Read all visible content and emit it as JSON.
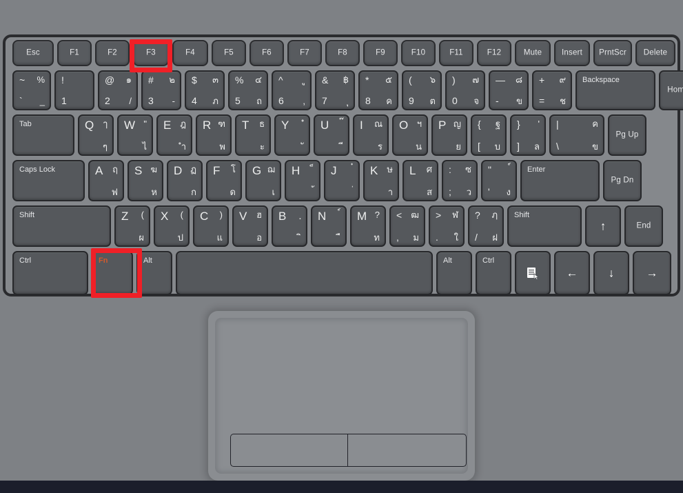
{
  "device": {
    "type": "laptop-keyboard",
    "colors": {
      "deck": "#85888c",
      "key_face": "#55585c",
      "key_border": "#27282b",
      "legend": "#e9eaec",
      "fn_legend": "#d4592c",
      "highlight": "#f02027",
      "background": "#7e8185",
      "palmrest": "#7e8185",
      "trackpad": "#8a8d91",
      "bottom_bar": "#1b1e2b"
    }
  },
  "highlights": [
    {
      "name": "f3-key-highlight",
      "target": "F3"
    },
    {
      "name": "fn-key-highlight",
      "target": "Fn"
    }
  ],
  "rows": [
    {
      "name": "function-row",
      "keys": [
        {
          "name": "key-esc",
          "label": "Esc",
          "style": "center"
        },
        {
          "name": "key-f1",
          "label": "F1",
          "style": "center"
        },
        {
          "name": "key-f2",
          "label": "F2",
          "style": "center"
        },
        {
          "name": "key-f3",
          "label": "F3",
          "style": "center"
        },
        {
          "name": "key-f4",
          "label": "F4",
          "style": "center"
        },
        {
          "name": "key-f5",
          "label": "F5",
          "style": "center"
        },
        {
          "name": "key-f6",
          "label": "F6",
          "style": "center"
        },
        {
          "name": "key-f7",
          "label": "F7",
          "style": "center"
        },
        {
          "name": "key-f8",
          "label": "F8",
          "style": "center"
        },
        {
          "name": "key-f9",
          "label": "F9",
          "style": "center"
        },
        {
          "name": "key-f10",
          "label": "F10",
          "style": "center"
        },
        {
          "name": "key-f11",
          "label": "F11",
          "style": "center"
        },
        {
          "name": "key-f12",
          "label": "F12",
          "style": "center"
        },
        {
          "name": "key-mute",
          "label": "Mute",
          "style": "center"
        },
        {
          "name": "key-insert",
          "label": "Insert",
          "style": "center"
        },
        {
          "name": "key-prntscr",
          "label": "PrntScr",
          "style": "center"
        },
        {
          "name": "key-delete",
          "label": "Delete",
          "style": "center"
        }
      ]
    },
    {
      "name": "number-row",
      "keys": [
        {
          "name": "key-grave",
          "style": "quad",
          "tl": "~",
          "tr": "%",
          "bl": "`",
          "br": "_"
        },
        {
          "name": "key-1",
          "style": "quad",
          "tl": "!",
          "tr": "",
          "bl": "1",
          "br": ""
        },
        {
          "name": "key-2",
          "style": "quad",
          "tl": "@",
          "tr": "๑",
          "bl": "2",
          "br": "/"
        },
        {
          "name": "key-3",
          "style": "quad",
          "tl": "#",
          "tr": "๒",
          "bl": "3",
          "br": "-"
        },
        {
          "name": "key-4",
          "style": "quad",
          "tl": "$",
          "tr": "๓",
          "bl": "4",
          "br": "ภ"
        },
        {
          "name": "key-5",
          "style": "quad",
          "tl": "%",
          "tr": "๔",
          "bl": "5",
          "br": "ถ"
        },
        {
          "name": "key-6",
          "style": "quad",
          "tl": "^",
          "tr": "ู",
          "bl": "6",
          "br": ","
        },
        {
          "name": "key-7",
          "style": "quad",
          "tl": "&",
          "tr": "฿",
          "bl": "7",
          "br": "ุ"
        },
        {
          "name": "key-8",
          "style": "quad",
          "tl": "*",
          "tr": "๕",
          "bl": "8",
          "br": "ค"
        },
        {
          "name": "key-9",
          "style": "quad",
          "tl": "(",
          "tr": "๖",
          "bl": "9",
          "br": "ต"
        },
        {
          "name": "key-0",
          "style": "quad",
          "tl": ")",
          "tr": "๗",
          "bl": "0",
          "br": "จ"
        },
        {
          "name": "key-minus",
          "style": "quad",
          "tl": "—",
          "tr": "๘",
          "bl": "-",
          "br": "ข"
        },
        {
          "name": "key-equal",
          "style": "quad",
          "tl": "+",
          "tr": "๙",
          "bl": "=",
          "br": "ช"
        },
        {
          "name": "key-backspace",
          "style": "tl",
          "label": "Backspace"
        },
        {
          "name": "key-home",
          "style": "center",
          "label": "Home"
        }
      ]
    },
    {
      "name": "qwerty-row",
      "keys": [
        {
          "name": "key-tab",
          "style": "tl",
          "label": "Tab"
        },
        {
          "name": "key-q",
          "style": "letter",
          "tl": "Q",
          "tr": "ๅ",
          "bl": "",
          "br": "ๆ"
        },
        {
          "name": "key-w",
          "style": "letter",
          "tl": "W",
          "tr": "\"",
          "bl": "",
          "br": "ไ"
        },
        {
          "name": "key-e",
          "style": "letter",
          "tl": "E",
          "tr": "ฎ",
          "bl": "",
          "br": "ำ"
        },
        {
          "name": "key-r",
          "style": "letter",
          "tl": "R",
          "tr": "ฑ",
          "bl": "",
          "br": "พ"
        },
        {
          "name": "key-t",
          "style": "letter",
          "tl": "T",
          "tr": "ธ",
          "bl": "",
          "br": "ะ"
        },
        {
          "name": "key-y",
          "style": "letter",
          "tl": "Y",
          "tr": "ํ",
          "bl": "",
          "br": "ั"
        },
        {
          "name": "key-u",
          "style": "letter",
          "tl": "U",
          "tr": "๊",
          "bl": "",
          "br": "ี"
        },
        {
          "name": "key-i",
          "style": "letter",
          "tl": "I",
          "tr": "ณ",
          "bl": "",
          "br": "ร"
        },
        {
          "name": "key-o",
          "style": "letter",
          "tl": "O",
          "tr": "ฯ",
          "bl": "",
          "br": "น"
        },
        {
          "name": "key-p",
          "style": "letter",
          "tl": "P",
          "tr": "ญ",
          "bl": "",
          "br": "ย"
        },
        {
          "name": "key-bracketleft",
          "style": "quad",
          "tl": "{",
          "tr": "ฐ",
          "bl": "[",
          "br": "บ"
        },
        {
          "name": "key-bracketright",
          "style": "quad",
          "tl": "}",
          "tr": "'",
          "bl": "]",
          "br": "ล"
        },
        {
          "name": "key-backslash",
          "style": "quad",
          "tl": "|",
          "tr": "ค",
          "bl": "\\",
          "br": "ข"
        },
        {
          "name": "key-pgup",
          "style": "center",
          "label": "Pg Up"
        }
      ]
    },
    {
      "name": "home-row",
      "keys": [
        {
          "name": "key-capslock",
          "style": "tl",
          "label": "Caps Lock"
        },
        {
          "name": "key-a",
          "style": "letter",
          "tl": "A",
          "tr": "ฤ",
          "bl": "",
          "br": "ฟ"
        },
        {
          "name": "key-s",
          "style": "letter",
          "tl": "S",
          "tr": "ฆ",
          "bl": "",
          "br": "ห"
        },
        {
          "name": "key-d",
          "style": "letter",
          "tl": "D",
          "tr": "ฏ",
          "bl": "",
          "br": "ก"
        },
        {
          "name": "key-f",
          "style": "letter",
          "tl": "F",
          "tr": "โ",
          "bl": "",
          "br": "ด"
        },
        {
          "name": "key-g",
          "style": "letter",
          "tl": "G",
          "tr": "ฌ",
          "bl": "",
          "br": "เ"
        },
        {
          "name": "key-h",
          "style": "letter",
          "tl": "H",
          "tr": "็",
          "bl": "",
          "br": "้"
        },
        {
          "name": "key-j",
          "style": "letter",
          "tl": "J",
          "tr": "๋",
          "bl": "",
          "br": "่"
        },
        {
          "name": "key-k",
          "style": "letter",
          "tl": "K",
          "tr": "ษ",
          "bl": "",
          "br": "า"
        },
        {
          "name": "key-l",
          "style": "letter",
          "tl": "L",
          "tr": "ศ",
          "bl": "",
          "br": "ส"
        },
        {
          "name": "key-semicolon",
          "style": "quad",
          "tl": ":",
          "tr": "ซ",
          "bl": ";",
          "br": "ว"
        },
        {
          "name": "key-quote",
          "style": "quad",
          "tl": "\"",
          "tr": "์",
          "bl": "'",
          "br": "ง"
        },
        {
          "name": "key-enter",
          "style": "tl",
          "label": "Enter"
        },
        {
          "name": "key-pgdn",
          "style": "center",
          "label": "Pg Dn"
        }
      ]
    },
    {
      "name": "shift-row",
      "keys": [
        {
          "name": "key-shift-left",
          "style": "tl",
          "label": "Shift"
        },
        {
          "name": "key-z",
          "style": "letter",
          "tl": "Z",
          "tr": "(",
          "bl": "",
          "br": "ผ"
        },
        {
          "name": "key-x",
          "style": "letter",
          "tl": "X",
          "tr": "(",
          "bl": "",
          "br": "ป"
        },
        {
          "name": "key-c",
          "style": "letter",
          "tl": "C",
          "tr": ")",
          "bl": "",
          "br": "แ"
        },
        {
          "name": "key-v",
          "style": "letter",
          "tl": "V",
          "tr": "ฮ",
          "bl": "",
          "br": "อ"
        },
        {
          "name": "key-b",
          "style": "letter",
          "tl": "B",
          "tr": "ฺ",
          "bl": "",
          "br": "ิ"
        },
        {
          "name": "key-n",
          "style": "letter",
          "tl": "N",
          "tr": "์",
          "bl": "",
          "br": "ื"
        },
        {
          "name": "key-m",
          "style": "letter",
          "tl": "M",
          "tr": "?",
          "bl": "",
          "br": "ท"
        },
        {
          "name": "key-comma",
          "style": "quad",
          "tl": "<",
          "tr": "ฒ",
          "bl": ",",
          "br": "ม"
        },
        {
          "name": "key-period",
          "style": "quad",
          "tl": ">",
          "tr": "ฬ",
          "bl": ".",
          "br": "ใ"
        },
        {
          "name": "key-slash",
          "style": "quad",
          "tl": "?",
          "tr": "ฦ",
          "bl": "/",
          "br": "ฝ"
        },
        {
          "name": "key-shift-right",
          "style": "tl",
          "label": "Shift"
        },
        {
          "name": "key-arrow-up",
          "style": "glyph",
          "glyph": "↑",
          "icon": "arrow-up-icon"
        },
        {
          "name": "key-end",
          "style": "center",
          "label": "End"
        }
      ]
    },
    {
      "name": "modifier-row",
      "keys": [
        {
          "name": "key-ctrl-left",
          "style": "tl",
          "label": "Ctrl"
        },
        {
          "name": "key-fn",
          "style": "tl-orange",
          "label": "Fn"
        },
        {
          "name": "key-alt-left",
          "style": "tl",
          "label": "Alt"
        },
        {
          "name": "key-space",
          "style": "blank",
          "label": ""
        },
        {
          "name": "key-alt-right",
          "style": "tl",
          "label": "Alt"
        },
        {
          "name": "key-ctrl-right",
          "style": "tl",
          "label": "Ctrl"
        },
        {
          "name": "key-menu",
          "style": "menu",
          "icon": "context-menu-icon"
        },
        {
          "name": "key-arrow-left",
          "style": "glyph",
          "glyph": "←",
          "icon": "arrow-left-icon"
        },
        {
          "name": "key-arrow-down",
          "style": "glyph",
          "glyph": "↓",
          "icon": "arrow-down-icon"
        },
        {
          "name": "key-arrow-right",
          "style": "glyph",
          "glyph": "→",
          "icon": "arrow-right-icon"
        }
      ]
    }
  ],
  "trackpad": {
    "name": "trackpad",
    "left_button_label": "",
    "right_button_label": ""
  }
}
